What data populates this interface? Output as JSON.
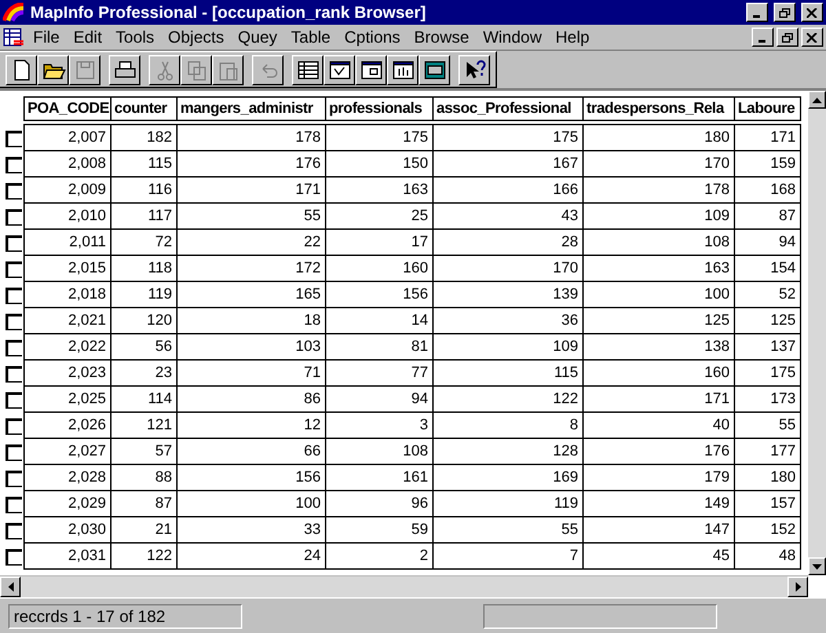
{
  "window": {
    "title": "MapInfo Professional - [occupation_rank Browser]"
  },
  "menu_bar": {
    "items": [
      "File",
      "Edit",
      "Tools",
      "Objects",
      "Quey",
      "Table",
      "Cptions",
      "Browse",
      "Window",
      "Help"
    ]
  },
  "toolbar": {
    "buttons": [
      {
        "kind": "new",
        "disabled": false
      },
      {
        "kind": "open",
        "disabled": false
      },
      {
        "kind": "save",
        "disabled": true
      },
      {
        "kind": "print",
        "disabled": false
      },
      {
        "kind": "cut",
        "disabled": true
      },
      {
        "kind": "copy",
        "disabled": true
      },
      {
        "kind": "paste",
        "disabled": true
      },
      {
        "kind": "undo",
        "disabled": true
      },
      {
        "kind": "browser",
        "disabled": false
      },
      {
        "kind": "map",
        "disabled": false
      },
      {
        "kind": "layout",
        "disabled": false
      },
      {
        "kind": "graph",
        "disabled": false
      },
      {
        "kind": "window",
        "disabled": false
      },
      {
        "kind": "help",
        "disabled": false
      }
    ]
  },
  "table": {
    "columns": [
      "POA_CODE",
      "counter",
      "mangers_administr",
      "professionals",
      "assoc_Professional",
      "tradespersons_Rela",
      "Laboure"
    ],
    "rows": [
      {
        "selected": false,
        "cells": [
          "2,007",
          "182",
          "178",
          "175",
          "175",
          "180",
          "171"
        ]
      },
      {
        "selected": false,
        "cells": [
          "2,008",
          "115",
          "176",
          "150",
          "167",
          "170",
          "159"
        ]
      },
      {
        "selected": false,
        "cells": [
          "2,009",
          "116",
          "171",
          "163",
          "166",
          "178",
          "168"
        ]
      },
      {
        "selected": false,
        "cells": [
          "2,010",
          "117",
          "55",
          "25",
          "43",
          "109",
          "87"
        ]
      },
      {
        "selected": false,
        "cells": [
          "2,011",
          "72",
          "22",
          "17",
          "28",
          "108",
          "94"
        ]
      },
      {
        "selected": false,
        "cells": [
          "2,015",
          "118",
          "172",
          "160",
          "170",
          "163",
          "154"
        ]
      },
      {
        "selected": false,
        "cells": [
          "2,018",
          "119",
          "165",
          "156",
          "139",
          "100",
          "52"
        ]
      },
      {
        "selected": false,
        "cells": [
          "2,021",
          "120",
          "18",
          "14",
          "36",
          "125",
          "125"
        ]
      },
      {
        "selected": false,
        "cells": [
          "2,022",
          "56",
          "103",
          "81",
          "109",
          "138",
          "137"
        ]
      },
      {
        "selected": false,
        "cells": [
          "2,023",
          "23",
          "71",
          "77",
          "115",
          "160",
          "175"
        ]
      },
      {
        "selected": false,
        "cells": [
          "2,025",
          "114",
          "86",
          "94",
          "122",
          "171",
          "173"
        ]
      },
      {
        "selected": false,
        "cells": [
          "2,026",
          "121",
          "12",
          "3",
          "8",
          "40",
          "55"
        ]
      },
      {
        "selected": false,
        "cells": [
          "2,027",
          "57",
          "66",
          "108",
          "128",
          "176",
          "177"
        ]
      },
      {
        "selected": false,
        "cells": [
          "2,028",
          "88",
          "156",
          "161",
          "169",
          "179",
          "180"
        ]
      },
      {
        "selected": false,
        "cells": [
          "2,029",
          "87",
          "100",
          "96",
          "119",
          "149",
          "157"
        ]
      },
      {
        "selected": false,
        "cells": [
          "2,030",
          "21",
          "33",
          "59",
          "55",
          "147",
          "152"
        ]
      },
      {
        "selected": false,
        "cells": [
          "2,031",
          "122",
          "24",
          "2",
          "7",
          "45",
          "48"
        ]
      }
    ]
  },
  "status_bar": {
    "text": "reccrds 1 - 17 of 182"
  }
}
